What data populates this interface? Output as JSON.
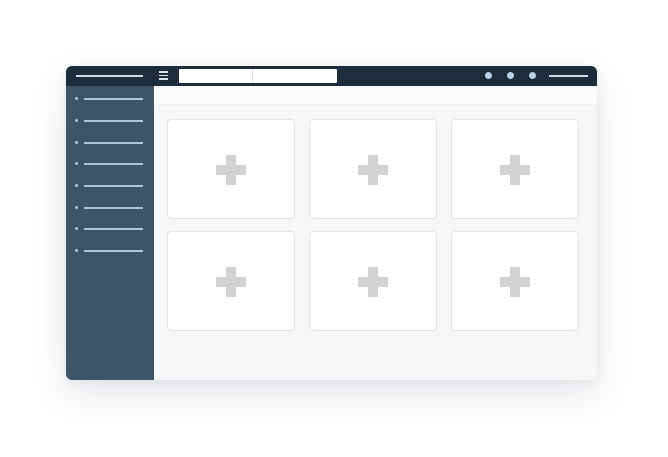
{
  "window": {
    "topbar": {
      "background": "#1e2d3b",
      "brand": "logo-placeholder",
      "menu_icon": "hamburger-icon",
      "search": {
        "value": "",
        "placeholder": ""
      },
      "indicator_dots": 3,
      "user_menu": "user-placeholder"
    },
    "sidebar": {
      "background": "#3d5567",
      "item_count": 8
    },
    "tiles": [
      {
        "icon": "plus-icon"
      },
      {
        "icon": "plus-icon"
      },
      {
        "icon": "plus-icon"
      },
      {
        "icon": "plus-icon"
      },
      {
        "icon": "plus-icon"
      },
      {
        "icon": "plus-icon"
      }
    ]
  }
}
